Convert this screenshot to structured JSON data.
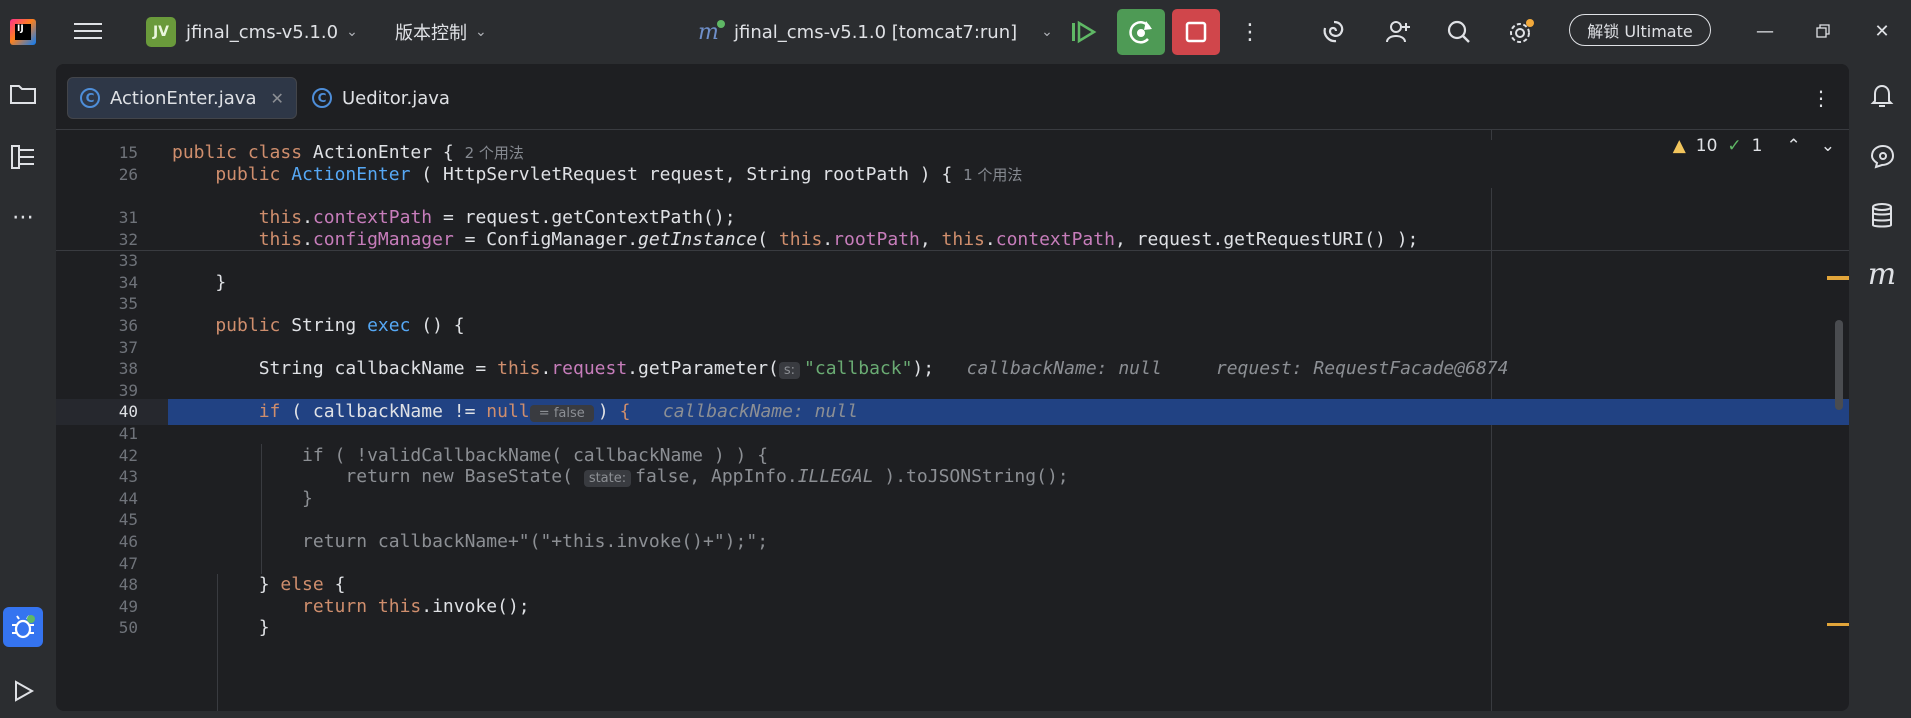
{
  "titlebar": {
    "project_badge": "JV",
    "project_name": "jfinal_cms-v5.1.0",
    "vcs_menu": "版本控制",
    "run_config": "jfinal_cms-v5.1.0 [tomcat7:run]",
    "ultimate_button": "解锁 Ultimate"
  },
  "tabs": [
    {
      "label": "ActionEnter.java",
      "active": true
    },
    {
      "label": "Ueditor.java",
      "active": false
    }
  ],
  "inspections": {
    "warnings": "10",
    "ok": "1"
  },
  "sticky": [
    {
      "num": "15",
      "parts": [
        [
          "kw",
          "public class "
        ],
        [
          "",
          "ActionEnter { "
        ],
        [
          "hint",
          "2 个用法"
        ]
      ]
    },
    {
      "num": "26",
      "parts": [
        [
          "kw",
          "    public "
        ],
        [
          "fn",
          "ActionEnter"
        ],
        [
          "",
          " ( HttpServletRequest request, String rootPath ) { "
        ],
        [
          "hint",
          "1 个用法"
        ]
      ]
    }
  ],
  "lines": [
    {
      "num": "31",
      "parts": [
        [
          "",
          "        "
        ],
        [
          "kw",
          "this"
        ],
        [
          "",
          "."
        ],
        [
          "fld",
          "contextPath"
        ],
        [
          "",
          " = request.getContextPath();"
        ]
      ]
    },
    {
      "num": "32",
      "parts": [
        [
          "",
          "        "
        ],
        [
          "kw",
          "this"
        ],
        [
          "",
          "."
        ],
        [
          "fld",
          "configManager"
        ],
        [
          "",
          " = ConfigManager."
        ],
        [
          "it",
          "getInstance"
        ],
        [
          "",
          "( "
        ],
        [
          "kw",
          "this"
        ],
        [
          "",
          "."
        ],
        [
          "fld",
          "rootPath"
        ],
        [
          "",
          ", "
        ],
        [
          "kw",
          "this"
        ],
        [
          "",
          "."
        ],
        [
          "fld",
          "contextPath"
        ],
        [
          "",
          ", request.getRequestURI() );"
        ]
      ]
    },
    {
      "num": "33",
      "parts": []
    },
    {
      "num": "34",
      "parts": [
        [
          "",
          "    }"
        ]
      ]
    },
    {
      "num": "35",
      "parts": []
    },
    {
      "num": "36",
      "parts": [
        [
          "kw",
          "    public "
        ],
        [
          "",
          "String "
        ],
        [
          "fn",
          "exec"
        ],
        [
          "",
          " () {"
        ]
      ]
    },
    {
      "num": "37",
      "parts": []
    },
    {
      "num": "38",
      "parts": [
        [
          "",
          "        String callbackName = "
        ],
        [
          "kw",
          "this"
        ],
        [
          "",
          "."
        ],
        [
          "fld",
          "request"
        ],
        [
          "",
          ".getParameter("
        ],
        [
          "phint",
          "s:"
        ],
        [
          "str",
          "\"callback\""
        ],
        [
          "",
          ");   "
        ],
        [
          "dbg",
          "callbackName: null     request: RequestFacade@6874"
        ]
      ]
    },
    {
      "num": "39",
      "parts": []
    },
    {
      "num": "40",
      "current": true,
      "parts": [
        [
          "",
          "        "
        ],
        [
          "kw",
          "if"
        ],
        [
          "",
          " ( callbackName != "
        ],
        [
          "kw",
          "null"
        ],
        [
          "phint",
          " = false "
        ],
        [
          "",
          ") "
        ],
        [
          "kw",
          "{"
        ],
        [
          "",
          "   "
        ],
        [
          "dbg",
          "callbackName: null"
        ]
      ]
    },
    {
      "num": "41",
      "parts": []
    },
    {
      "num": "42",
      "parts": [
        [
          "dimtxt",
          "            if ( !validCallbackName( callbackName ) ) {"
        ]
      ]
    },
    {
      "num": "43",
      "parts": [
        [
          "dimtxt",
          "                return new BaseState( "
        ],
        [
          "phint",
          "state:"
        ],
        [
          "dimtxt",
          "false, AppInfo."
        ],
        [
          "dimtxt it",
          "ILLEGAL"
        ],
        [
          "dimtxt",
          " ).toJSONString();"
        ]
      ]
    },
    {
      "num": "44",
      "parts": [
        [
          "dimtxt",
          "            }"
        ]
      ]
    },
    {
      "num": "45",
      "parts": []
    },
    {
      "num": "46",
      "parts": [
        [
          "dimtxt",
          "            return callbackName+\"(\"+this.invoke()+\");\";"
        ]
      ]
    },
    {
      "num": "47",
      "parts": []
    },
    {
      "num": "48",
      "parts": [
        [
          "",
          "        } "
        ],
        [
          "kw",
          "else"
        ],
        [
          "",
          " {"
        ]
      ]
    },
    {
      "num": "49",
      "parts": [
        [
          "kw",
          "            return this"
        ],
        [
          "",
          ".invoke();"
        ]
      ]
    },
    {
      "num": "50",
      "parts": [
        [
          "",
          "        }"
        ]
      ]
    }
  ],
  "colors": {
    "accent": "#214283",
    "run_green": "#4e9a55",
    "stop_red": "#d0464b",
    "warning": "#f2c55c"
  }
}
